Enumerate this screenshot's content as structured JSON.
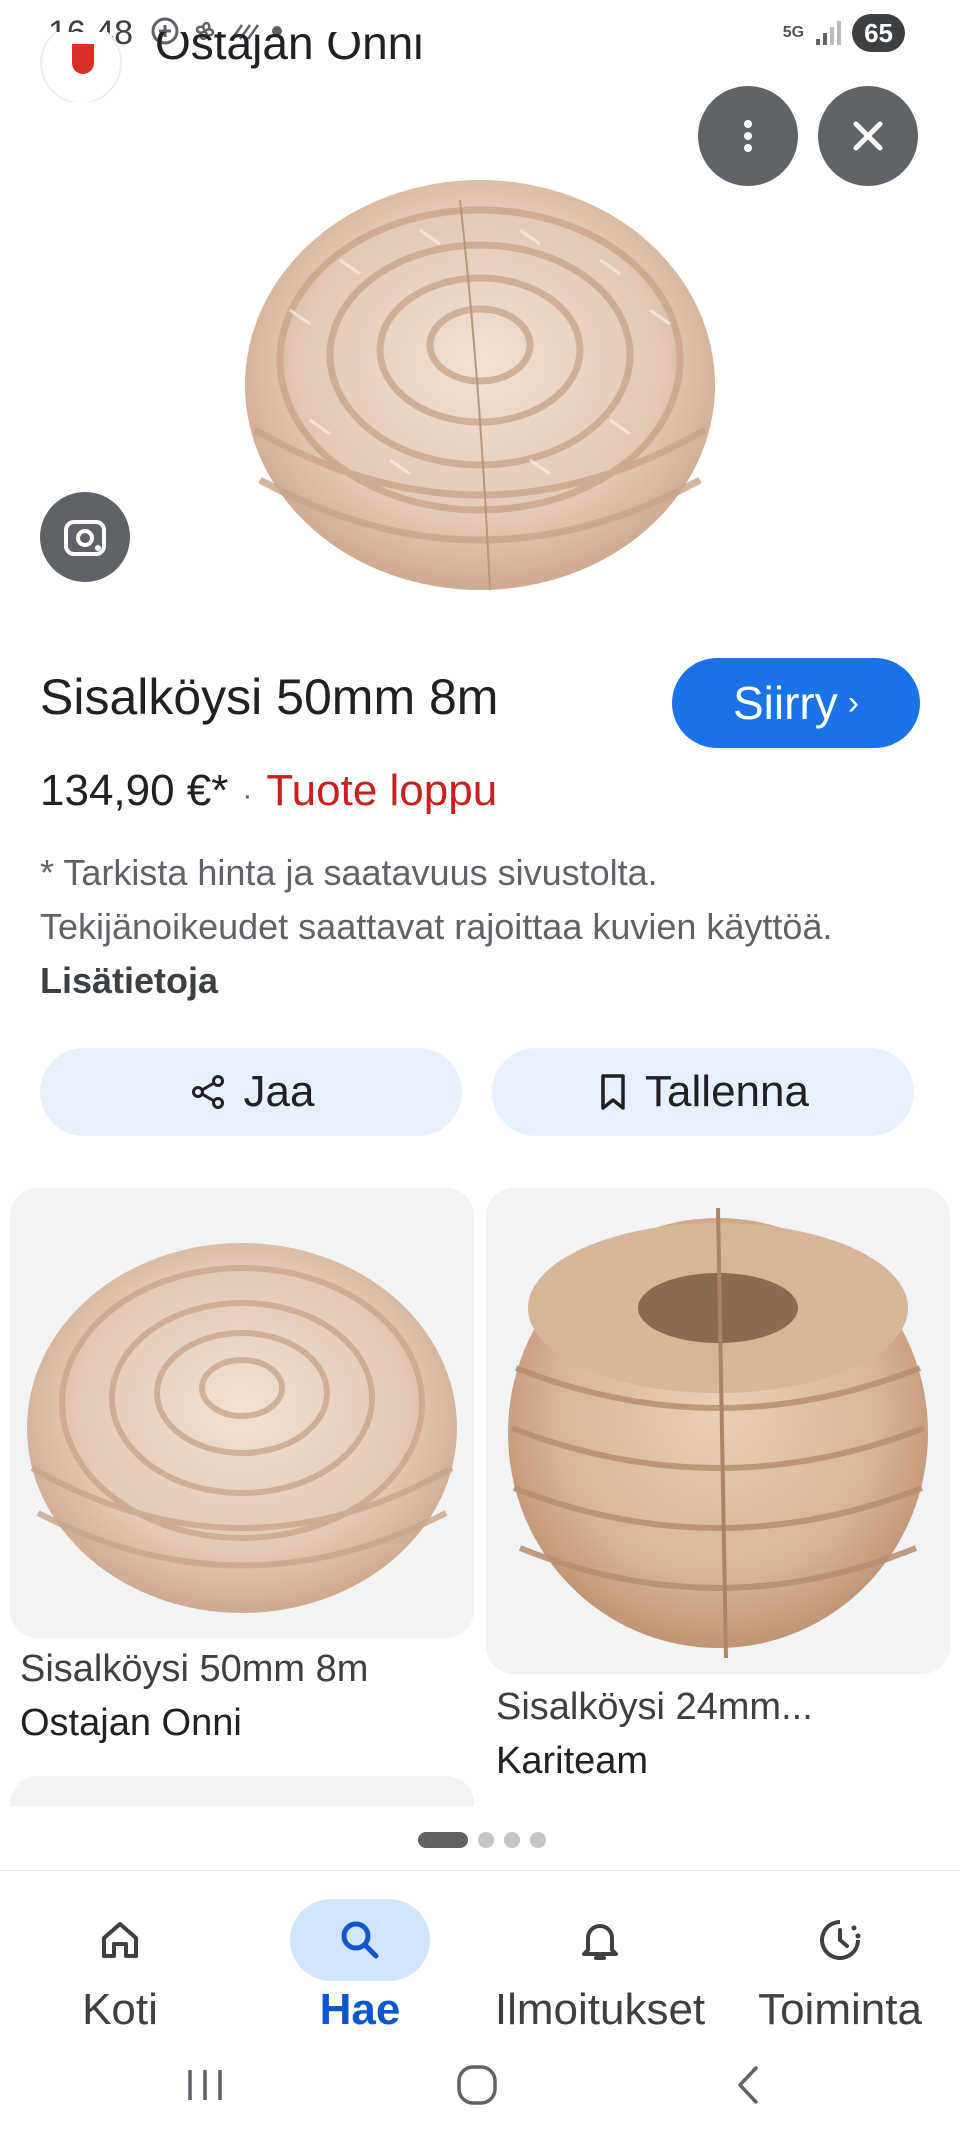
{
  "status_bar": {
    "time": "16.48",
    "network": "5G",
    "battery": "65"
  },
  "source": {
    "name": "Ostajan Onni"
  },
  "product": {
    "title": "Sisalköysi 50mm 8m",
    "go_label": "Siirry",
    "price": "134,90 €*",
    "separator": "·",
    "stock": "Tuote loppu",
    "disclaimer": "* Tarkista hinta ja saatavuus sivustolta. Tekijänoikeudet saattavat rajoittaa kuvien käyttöä.",
    "more_info_link": "Lisätietoja"
  },
  "actions": {
    "share_label": "Jaa",
    "save_label": "Tallenna"
  },
  "related": [
    {
      "title": "Sisalköysi 50mm 8m",
      "source": "Ostajan Onni"
    },
    {
      "title": "Sisalköysi 24mm...",
      "source": "Kariteam"
    }
  ],
  "bottom_nav": [
    {
      "label": "Koti",
      "icon": "home-icon",
      "active": false
    },
    {
      "label": "Hae",
      "icon": "search-icon",
      "active": true
    },
    {
      "label": "Ilmoitukset",
      "icon": "bell-icon",
      "active": false
    },
    {
      "label": "Toiminta",
      "icon": "activity-icon",
      "active": false
    }
  ],
  "colors": {
    "accent": "#1a73e8",
    "stock_out": "#c5221f",
    "pill_bg": "#e8f0fe",
    "active_nav": "#d3e3fd"
  }
}
